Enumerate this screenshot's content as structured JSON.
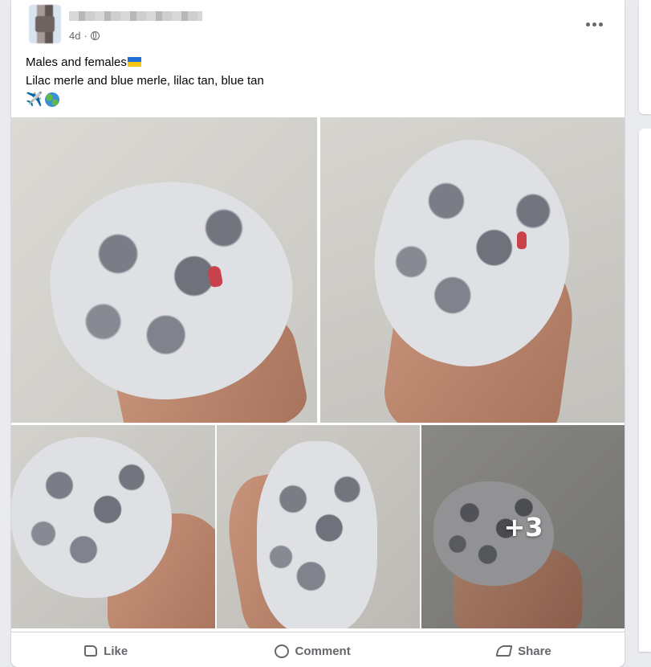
{
  "post": {
    "time": "4d",
    "separator": "·",
    "text_line1": "Males and females",
    "text_line2": "Lilac merle and blue merle, lilac tan, blue tan",
    "emoji_plane": "✈️",
    "photos_more_count": "+3"
  },
  "actions": {
    "like": "Like",
    "comment": "Comment",
    "share": "Share"
  },
  "colors": {
    "background": "#e9ebee",
    "card": "#ffffff",
    "meta_text": "#65676b",
    "nail_polish": "#c8424c"
  },
  "icons": [
    "globe-icon",
    "more-icon",
    "ukraine-flag-icon",
    "airplane-icon",
    "earth-icon",
    "like-icon",
    "comment-icon",
    "share-icon"
  ]
}
